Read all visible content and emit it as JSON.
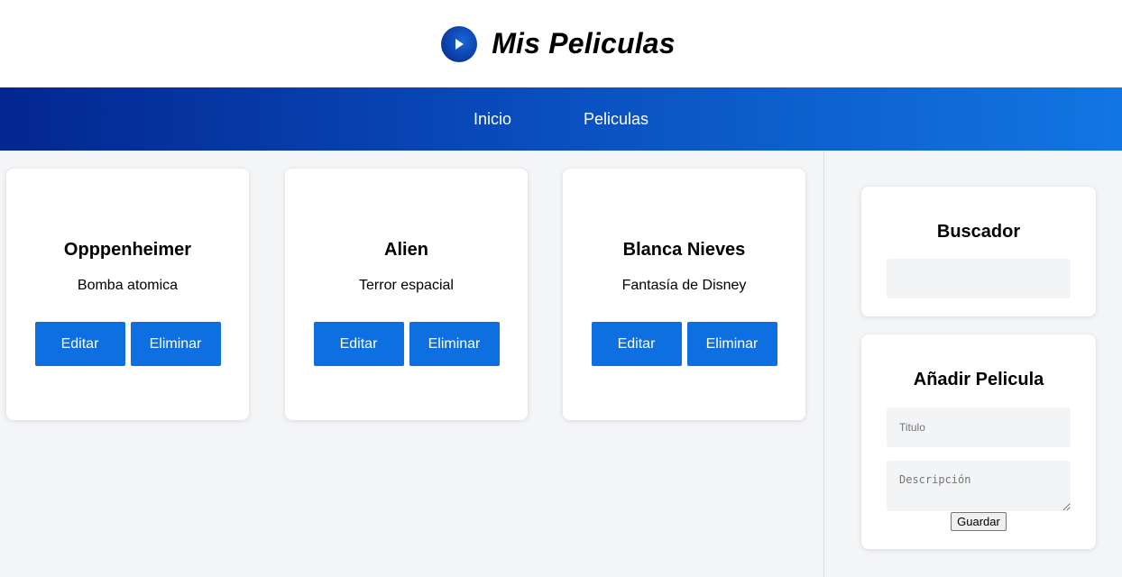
{
  "header": {
    "title": "Mis Peliculas",
    "logo_icon": "play-icon"
  },
  "nav": {
    "items": [
      "Inicio",
      "Peliculas"
    ]
  },
  "movies": [
    {
      "title": "Opppenheimer",
      "description": "Bomba atomica",
      "edit_label": "Editar",
      "delete_label": "Eliminar"
    },
    {
      "title": "Alien",
      "description": "Terror espacial",
      "edit_label": "Editar",
      "delete_label": "Eliminar"
    },
    {
      "title": "Blanca Nieves",
      "description": "Fantasía de Disney",
      "edit_label": "Editar",
      "delete_label": "Eliminar"
    }
  ],
  "search": {
    "title": "Buscador",
    "value": "",
    "placeholder": ""
  },
  "add_form": {
    "title": "Añadir Pelicula",
    "title_placeholder": "Titulo",
    "description_placeholder": "Descripción",
    "save_label": "Guardar"
  },
  "colors": {
    "primary": "#0e6fe0",
    "nav_start": "#032690",
    "nav_end": "#1276e2",
    "background": "#f4f5f7"
  }
}
